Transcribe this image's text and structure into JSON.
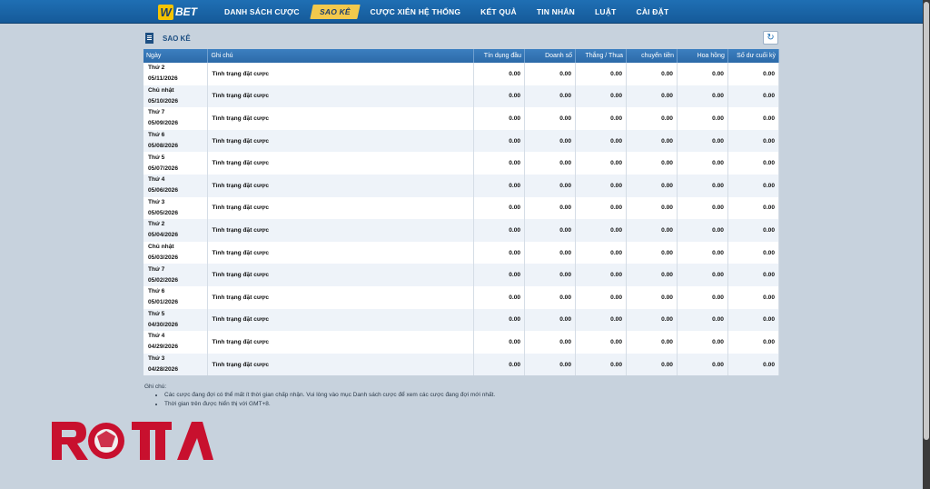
{
  "brand": {
    "logo_letter": "W",
    "logo_text": "BET"
  },
  "nav": {
    "items": [
      "DANH SÁCH CƯỢC",
      "SAO KÊ",
      "CƯỢC XIÊN HỆ THỐNG",
      "KẾT QUẢ",
      "TIN NHẮN",
      "LUẬT",
      "CÀI ĐẶT"
    ],
    "active": "SAO KÊ"
  },
  "panel": {
    "title": "SAO KÊ",
    "refresh_icon": "refresh-icon"
  },
  "table": {
    "headers": [
      "Ngày",
      "Ghi chú",
      "Tín dụng đầu",
      "Doanh số",
      "Thắng / Thua",
      "chuyển tiền",
      "Hoa hồng",
      "Số dư cuối kỳ"
    ],
    "rows": [
      {
        "day": "Thứ 2",
        "date": "05/11/2026",
        "note": "Tình trạng đặt cược",
        "values": [
          "0.00",
          "0.00",
          "0.00",
          "0.00",
          "0.00",
          "0.00"
        ]
      },
      {
        "day": "Chủ nhật",
        "date": "05/10/2026",
        "note": "Tình trạng đặt cược",
        "values": [
          "0.00",
          "0.00",
          "0.00",
          "0.00",
          "0.00",
          "0.00"
        ]
      },
      {
        "day": "Thứ 7",
        "date": "05/09/2026",
        "note": "Tình trạng đặt cược",
        "values": [
          "0.00",
          "0.00",
          "0.00",
          "0.00",
          "0.00",
          "0.00"
        ]
      },
      {
        "day": "Thứ 6",
        "date": "05/08/2026",
        "note": "Tình trạng đặt cược",
        "values": [
          "0.00",
          "0.00",
          "0.00",
          "0.00",
          "0.00",
          "0.00"
        ]
      },
      {
        "day": "Thứ 5",
        "date": "05/07/2026",
        "note": "Tình trạng đặt cược",
        "values": [
          "0.00",
          "0.00",
          "0.00",
          "0.00",
          "0.00",
          "0.00"
        ]
      },
      {
        "day": "Thứ 4",
        "date": "05/06/2026",
        "note": "Tình trạng đặt cược",
        "values": [
          "0.00",
          "0.00",
          "0.00",
          "0.00",
          "0.00",
          "0.00"
        ]
      },
      {
        "day": "Thứ 3",
        "date": "05/05/2026",
        "note": "Tình trạng đặt cược",
        "values": [
          "0.00",
          "0.00",
          "0.00",
          "0.00",
          "0.00",
          "0.00"
        ]
      },
      {
        "day": "Thứ 2",
        "date": "05/04/2026",
        "note": "Tình trạng đặt cược",
        "values": [
          "0.00",
          "0.00",
          "0.00",
          "0.00",
          "0.00",
          "0.00"
        ]
      },
      {
        "day": "Chủ nhật",
        "date": "05/03/2026",
        "note": "Tình trạng đặt cược",
        "values": [
          "0.00",
          "0.00",
          "0.00",
          "0.00",
          "0.00",
          "0.00"
        ]
      },
      {
        "day": "Thứ 7",
        "date": "05/02/2026",
        "note": "Tình trạng đặt cược",
        "values": [
          "0.00",
          "0.00",
          "0.00",
          "0.00",
          "0.00",
          "0.00"
        ]
      },
      {
        "day": "Thứ 6",
        "date": "05/01/2026",
        "note": "Tình trạng đặt cược",
        "values": [
          "0.00",
          "0.00",
          "0.00",
          "0.00",
          "0.00",
          "0.00"
        ]
      },
      {
        "day": "Thứ 5",
        "date": "04/30/2026",
        "note": "Tình trạng đặt cược",
        "values": [
          "0.00",
          "0.00",
          "0.00",
          "0.00",
          "0.00",
          "0.00"
        ]
      },
      {
        "day": "Thứ 4",
        "date": "04/29/2026",
        "note": "Tình trạng đặt cược",
        "values": [
          "0.00",
          "0.00",
          "0.00",
          "0.00",
          "0.00",
          "0.00"
        ]
      },
      {
        "day": "Thứ 3",
        "date": "04/28/2026",
        "note": "Tình trạng đặt cược",
        "values": [
          "0.00",
          "0.00",
          "0.00",
          "0.00",
          "0.00",
          "0.00"
        ]
      }
    ]
  },
  "footnote": {
    "title": "Ghi chú:",
    "items": [
      "Các cược đang đợi có thể mất ít thời gian chấp nhận. Vui lòng vào mục Danh sách cược để xem các cược đang đợi mới nhất.",
      "Thời gian trên được hiển thị với GMT+8."
    ]
  },
  "watermark": {
    "text": "ROMA",
    "color": "#c8102e"
  },
  "colors": {
    "topbar": "#1f6fb4",
    "active_tab": "#f2c94c",
    "table_header": "#2c6aa8",
    "page_bg": "#c7d2dd"
  }
}
